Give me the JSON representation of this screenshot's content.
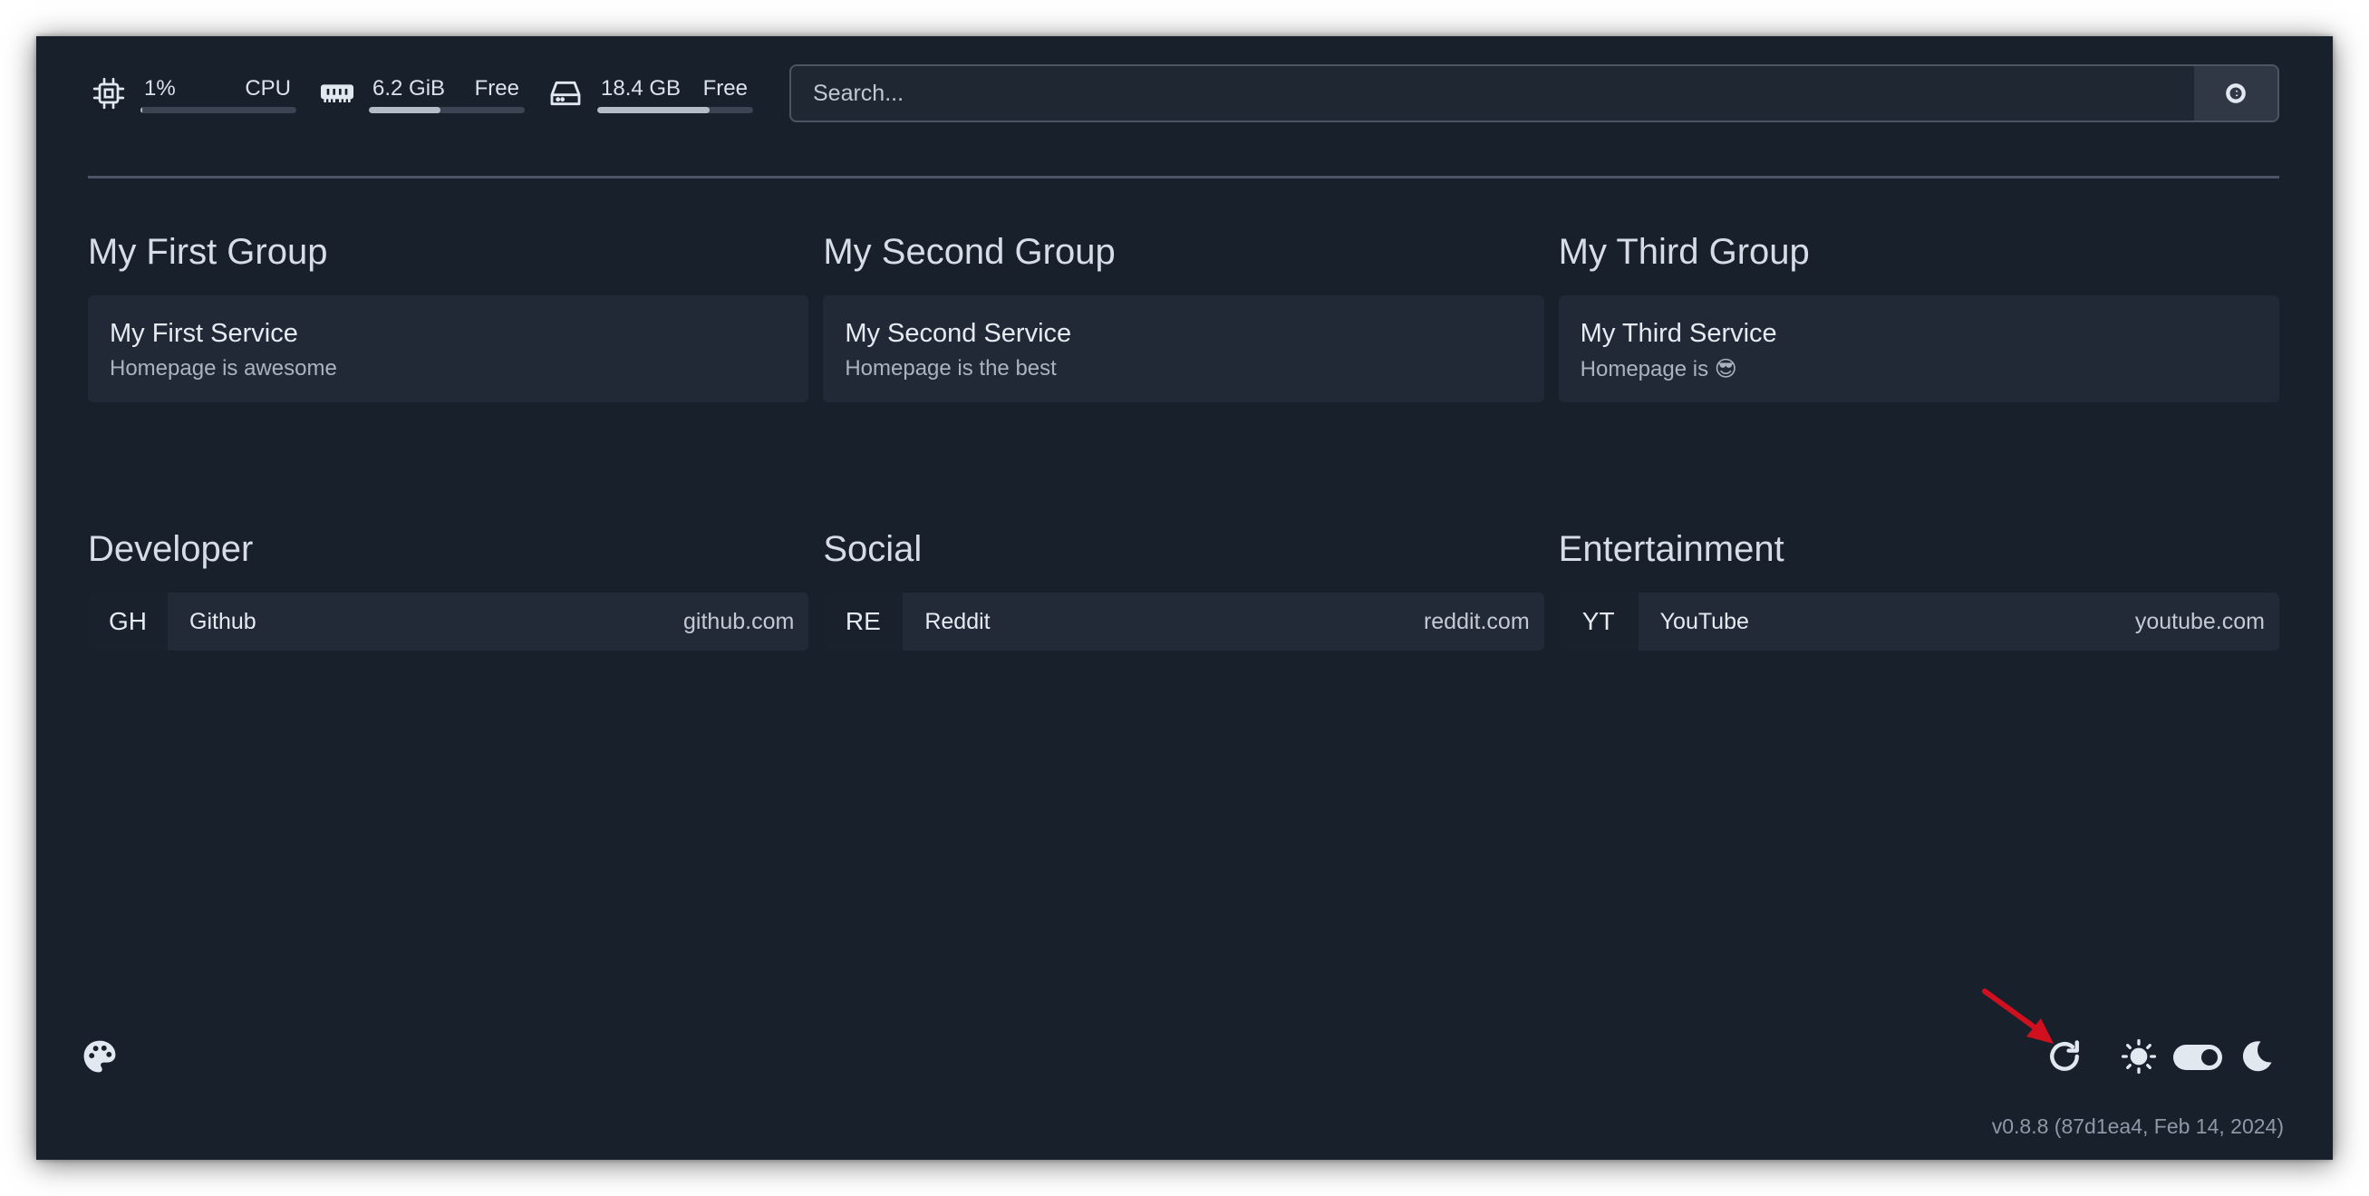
{
  "widgets": {
    "cpu": {
      "value": "1%",
      "label": "CPU",
      "usage": 0.01
    },
    "memory": {
      "value": "6.2 GiB",
      "label": "Free",
      "usage": 0.46
    },
    "disk": {
      "value": "18.4 GB",
      "label": "Free",
      "usage": 0.72
    }
  },
  "search": {
    "placeholder": "Search..."
  },
  "groups": [
    {
      "title": "My First Group",
      "service": {
        "name": "My First Service",
        "description": "Homepage is awesome"
      }
    },
    {
      "title": "My Second Group",
      "service": {
        "name": "My Second Service",
        "description": "Homepage is the best"
      }
    },
    {
      "title": "My Third Group",
      "service": {
        "name": "My Third Service",
        "description": "Homepage is 😎"
      }
    }
  ],
  "bookmark_groups": [
    {
      "title": "Developer",
      "bookmark": {
        "abbr": "GH",
        "name": "Github",
        "url": "github.com"
      }
    },
    {
      "title": "Social",
      "bookmark": {
        "abbr": "RE",
        "name": "Reddit",
        "url": "reddit.com"
      }
    },
    {
      "title": "Entertainment",
      "bookmark": {
        "abbr": "YT",
        "name": "YouTube",
        "url": "youtube.com"
      }
    }
  ],
  "footer": {
    "version": "v0.8.8 (87d1ea4, Feb 14, 2024)",
    "icons": [
      "palette-icon",
      "refresh-icon",
      "sun-icon",
      "toggle",
      "moon-icon"
    ],
    "theme_toggle_on": true
  },
  "colors": {
    "background": "#18202c",
    "card": "#212936",
    "annotation_arrow": "#d0101e"
  }
}
